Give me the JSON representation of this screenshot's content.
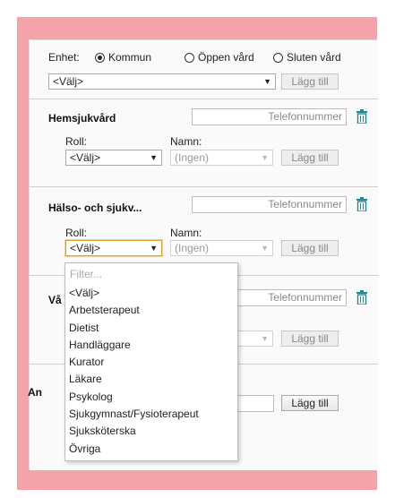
{
  "unit_row": {
    "label": "Enhet:",
    "options": [
      {
        "label": "Kommun",
        "selected": true
      },
      {
        "label": "Öppen vård",
        "selected": false
      },
      {
        "label": "Sluten vård",
        "selected": false
      }
    ],
    "select_value": "<Välj>",
    "add_label": "Lägg till"
  },
  "sections": [
    {
      "title": "Hemsjukvård",
      "phone_placeholder": "Telefonnummer",
      "role_label": "Roll:",
      "role_value": "<Välj>",
      "name_label": "Namn:",
      "name_value": "(Ingen)",
      "add_label": "Lägg till"
    },
    {
      "title": "Hälso- och sjukv...",
      "phone_placeholder": "Telefonnummer",
      "role_label": "Roll:",
      "role_value": "<Välj>",
      "name_label": "Namn:",
      "name_value": "(Ingen)",
      "add_label": "Lägg till"
    },
    {
      "title_fragment": "Vå",
      "phone_placeholder": "Telefonnummer",
      "add_label": "Lägg till"
    },
    {
      "title_fragment": "An",
      "add_label": "Lägg till"
    }
  ],
  "role_dropdown": {
    "filter_placeholder": "Filter...",
    "options": [
      "<Välj>",
      "Arbetsterapeut",
      "Dietist",
      "Handläggare",
      "Kurator",
      "Läkare",
      "Psykolog",
      "Sjukgymnast/Fysioterapeut",
      "Sjuksköterska",
      "Övriga"
    ]
  },
  "icons": {
    "trash": "trash-icon",
    "dropdown_arrow": "chevron-down-icon"
  },
  "colors": {
    "frame": "#f4a3aa",
    "trash": "#1f8a9a",
    "focus_border": "#e0a030"
  }
}
